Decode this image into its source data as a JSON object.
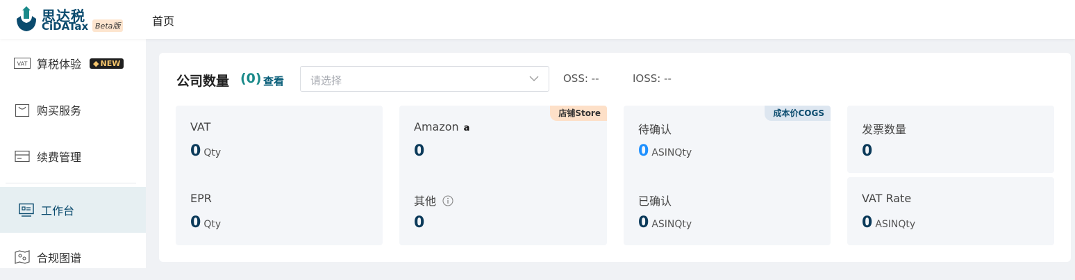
{
  "header": {
    "logo_cn": "思达税",
    "logo_en": "CiDATax",
    "beta_label": "Beta版",
    "nav_home": "首页"
  },
  "sidebar": {
    "items": [
      {
        "label": "算税体验",
        "icon": "vat-icon",
        "badge": "NEW"
      },
      {
        "label": "购买服务",
        "icon": "shopping-bag-icon"
      },
      {
        "label": "续费管理",
        "icon": "card-icon"
      },
      {
        "label": "工作台",
        "icon": "dashboard-icon",
        "active": true
      },
      {
        "label": "合规图谱",
        "icon": "map-icon"
      }
    ],
    "vat_icon_text": "VAT"
  },
  "panel": {
    "title": "公司数量",
    "count": "(0)",
    "view_link": "查看",
    "select_placeholder": "请选择",
    "oss": "OSS:  --",
    "ioss": "IOSS:  --"
  },
  "cards": {
    "vat": {
      "label": "VAT",
      "value": "0",
      "unit": "Qty"
    },
    "epr": {
      "label": "EPR",
      "value": "0",
      "unit": "Qty"
    },
    "amazon": {
      "label": "Amazon",
      "value": "0",
      "ribbon": "店铺Store",
      "logo_glyph": "a"
    },
    "other": {
      "label": "其他",
      "value": "0"
    },
    "pending": {
      "label": "待确认",
      "value": "0",
      "unit": "ASINQty",
      "ribbon": "成本价COGS"
    },
    "confirmed": {
      "label": "已确认",
      "value": "0",
      "unit": "ASINQty"
    },
    "invoices": {
      "label": "发票数量",
      "value": "0"
    },
    "vat_rate": {
      "label": "VAT Rate",
      "value": "0",
      "unit": "ASINQty"
    }
  },
  "colors": {
    "brand": "#0b4b6e",
    "accent_teal": "#1a8a8a",
    "link_blue": "#1e90ff",
    "active_bg": "#e6eff2"
  }
}
